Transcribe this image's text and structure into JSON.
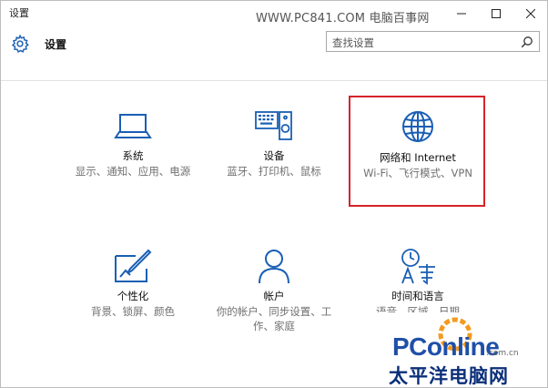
{
  "window": {
    "title": "设置",
    "watermark": "WWW.PC841.COM 电脑百事网"
  },
  "header": {
    "title": "设置",
    "search_placeholder": "查找设置"
  },
  "tiles": [
    {
      "title": "系统",
      "desc": "显示、通知、应用、电源",
      "icon": "laptop-icon"
    },
    {
      "title": "设备",
      "desc": "蓝牙、打印机、鼠标",
      "icon": "devices-icon"
    },
    {
      "title": "网络和 Internet",
      "desc": "Wi-Fi、飞行模式、VPN",
      "icon": "globe-icon"
    },
    {
      "title": "个性化",
      "desc": "背景、锁屏、颜色",
      "icon": "personalization-icon"
    },
    {
      "title": "帐户",
      "desc": "你的帐户、同步设置、工作、家庭",
      "icon": "person-icon"
    },
    {
      "title": "时间和语言",
      "desc": "语音、区域、日期",
      "icon": "time-language-icon"
    }
  ],
  "logo": {
    "main_left": "PC",
    "main_right": "online",
    "sub": ".com.cn",
    "cn": "太平洋电脑网"
  },
  "colors": {
    "accent": "#1a5fb4",
    "highlight": "#d6232a",
    "logo_blue": "#1f4fa8",
    "logo_orange": "#f39a1e"
  }
}
